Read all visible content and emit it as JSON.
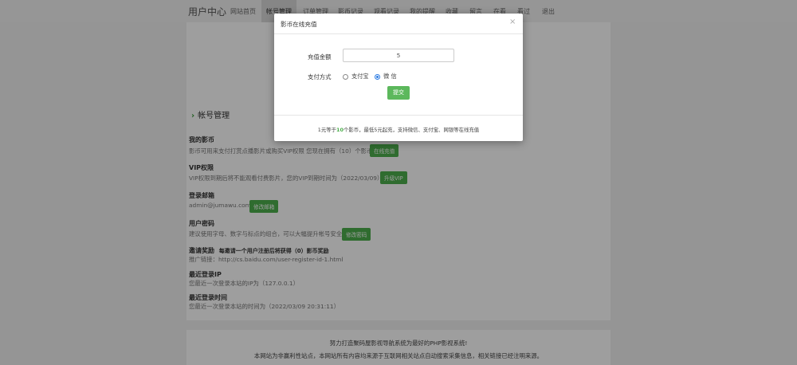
{
  "topnav": {
    "brand": "用户中心",
    "items": [
      {
        "label": "网站首页"
      },
      {
        "label": "帐号管理"
      },
      {
        "label": "订单管理"
      },
      {
        "label": "影币记录"
      },
      {
        "label": "观看记录"
      },
      {
        "label": "我的提醒"
      },
      {
        "label": "收藏"
      },
      {
        "label": "留言"
      },
      {
        "label": "在看"
      },
      {
        "label": "看过"
      },
      {
        "label": "退出"
      }
    ],
    "active_index": 1
  },
  "account": {
    "section_title": "帐号管理",
    "coins": {
      "title": "我的影币",
      "desc": "影币可用来支付打赏点播影片或购买VIP权限 您现在拥有（10）个影币",
      "button": "在线充值"
    },
    "vip": {
      "title": "VIP权限",
      "desc": "VIP权限到期后将不能观看付费影片，您的VIP到期时间为（2022/03/09）",
      "button": "升级VIP"
    },
    "email": {
      "title": "登录邮箱",
      "desc": "admin@jumawu.com",
      "button": "修改邮箱"
    },
    "password": {
      "title": "用户密码",
      "desc": "建议使用字母、数字与标点的组合，可以大幅提升帐号安全",
      "button": "修改密码"
    },
    "invite": {
      "title": "邀请奖励",
      "title_note": "每邀请一个用户注册后将获得（0）影币奖励",
      "desc": "推广链接：http://cs.baidu.com/user-register-id-1.html"
    },
    "last_ip": {
      "title": "最近登录IP",
      "desc": "您最近一次登录本站的IP为（127.0.0.1）"
    },
    "last_time": {
      "title": "最近登录时间",
      "desc": "您最近一次登录本站的时间为（2022/03/09 20:31:11）"
    }
  },
  "footer": {
    "line1": "努力打造聚码屋影视导航系统为最好的PHP影视系统!",
    "line2": "本网站为非赢利性站点，本网站所有内容均来源于互联网相关站点自动搜索采集信息，相关链接已经注明来源。"
  },
  "modal": {
    "title": "影币在线充值",
    "close": "×",
    "amount_label": "充值金额",
    "amount_value": "5",
    "method_label": "支付方式",
    "methods": [
      {
        "label": "支付宝",
        "checked": false
      },
      {
        "label": "微 信",
        "checked": true
      }
    ],
    "submit": "提交",
    "note_pre": "1元等于",
    "note_hl": "10",
    "note_post": "个影币，最低5元起充，支持微信、支付宝、网银等在线充值"
  },
  "colors": {
    "accent_green": "#5cb85c",
    "radio_blue": "#2a7ae2",
    "overlay": "rgba(0,0,0,0.38)"
  }
}
